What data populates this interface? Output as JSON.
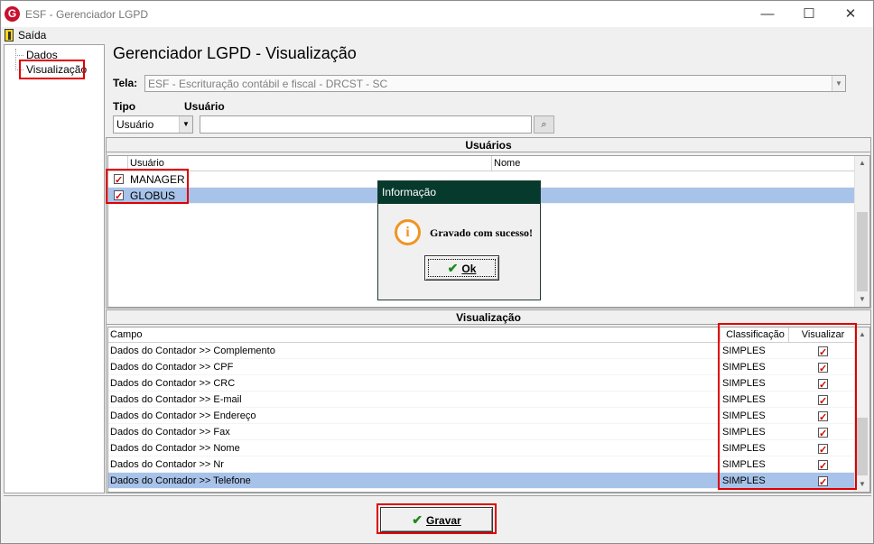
{
  "window": {
    "title": "ESF - Gerenciador LGPD",
    "app_icon_letter": "G",
    "minimize_glyph": "—",
    "maximize_glyph": "☐",
    "close_glyph": "✕"
  },
  "menu": {
    "exit_label": "Saída",
    "exit_icon": "door-exit-icon"
  },
  "tree": {
    "items": [
      {
        "label": "Dados"
      },
      {
        "label": "Visualização",
        "selected": true
      }
    ]
  },
  "header": {
    "title": "Gerenciador LGPD - Visualização"
  },
  "form": {
    "tela_label": "Tela:",
    "tela_value": "ESF - Escrituração contábil e fiscal - DRCST - SC",
    "tipo_label": "Tipo",
    "tipo_value": "Usuário",
    "usuario_label": "Usuário",
    "usuario_value": "",
    "search_icon": "binoculars-icon"
  },
  "users_panel": {
    "title": "Usuários",
    "columns": [
      "Usuário",
      "Nome"
    ],
    "rows": [
      {
        "checked": true,
        "usuario": "MANAGER",
        "nome": "",
        "selected": false
      },
      {
        "checked": true,
        "usuario": "GLOBUS",
        "nome": "",
        "selected": true
      }
    ]
  },
  "view_panel": {
    "title": "Visualização",
    "columns": [
      "Campo",
      "Classificação",
      "Visualizar"
    ],
    "rows": [
      {
        "campo": "Dados do Contador >> Complemento",
        "classificacao": "SIMPLES",
        "visualizar": true
      },
      {
        "campo": "Dados do Contador >> CPF",
        "classificacao": "SIMPLES",
        "visualizar": true
      },
      {
        "campo": "Dados do Contador >> CRC",
        "classificacao": "SIMPLES",
        "visualizar": true
      },
      {
        "campo": "Dados do Contador >> E-mail",
        "classificacao": "SIMPLES",
        "visualizar": true
      },
      {
        "campo": "Dados do Contador >> Endereço",
        "classificacao": "SIMPLES",
        "visualizar": true
      },
      {
        "campo": "Dados do Contador >> Fax",
        "classificacao": "SIMPLES",
        "visualizar": true
      },
      {
        "campo": "Dados do Contador >> Nome",
        "classificacao": "SIMPLES",
        "visualizar": true
      },
      {
        "campo": "Dados do Contador >> Nr",
        "classificacao": "SIMPLES",
        "visualizar": true
      },
      {
        "campo": "Dados do Contador >> Telefone",
        "classificacao": "SIMPLES",
        "visualizar": true,
        "selected": true
      }
    ]
  },
  "dialog": {
    "title": "Informação",
    "message": "Gravado com sucesso!",
    "ok_label": "Ok",
    "icon": "info-icon"
  },
  "footer": {
    "save_label": "Gravar"
  },
  "colors": {
    "dialog_title_bg": "#063a2c",
    "selection": "#a8c3ea",
    "highlight_box": "#e00000",
    "info_icon": "#f29422"
  }
}
